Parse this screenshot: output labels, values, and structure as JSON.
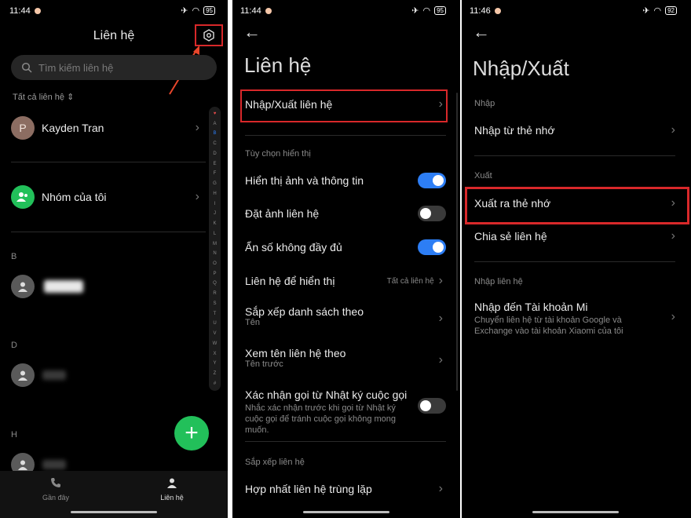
{
  "colors": {
    "accent": "#2d7ef5",
    "highlight": "#d8282a",
    "fab": "#22c05a",
    "background": "#000000"
  },
  "panel1": {
    "status": {
      "time": "11:44",
      "battery": "95"
    },
    "title": "Liên hệ",
    "search_placeholder": "Tìm kiếm liên hệ",
    "filter_label": "Tất cả liên hệ",
    "contacts": [
      {
        "initial": "P",
        "name": "Kayden Tran"
      },
      {
        "name": "Nhóm của tôi"
      }
    ],
    "section_b": "B",
    "section_d": "D",
    "section_h": "H",
    "alpha_index": [
      "♥",
      "A",
      "B",
      "C",
      "D",
      "E",
      "F",
      "G",
      "H",
      "I",
      "J",
      "K",
      "L",
      "M",
      "N",
      "O",
      "P",
      "Q",
      "R",
      "S",
      "T",
      "U",
      "V",
      "W",
      "X",
      "Y",
      "Z",
      "#"
    ],
    "tabs": [
      {
        "label": "Gần đây",
        "icon": "phone-icon"
      },
      {
        "label": "Liên hệ",
        "icon": "person-icon"
      }
    ]
  },
  "panel2": {
    "status": {
      "time": "11:44",
      "battery": "95"
    },
    "title": "Liên hệ",
    "import_export": "Nhập/Xuất liên hệ",
    "display_options_header": "Tùy chọn hiển thị",
    "rows": {
      "show_photo": "Hiển thị ảnh và thông tin",
      "set_photo": "Đặt ảnh liên hệ",
      "hide_incomplete": "Ẩn số không đầy đủ",
      "contacts_to_display": "Liên hệ để hiển thị",
      "contacts_to_display_value": "Tất cả liên hệ",
      "sort_by": "Sắp xếp danh sách theo",
      "sort_by_value": "Tên",
      "view_name_by": "Xem tên liên hệ theo",
      "view_name_by_value": "Tên trước",
      "confirm_call": "Xác nhận gọi từ Nhật ký cuộc gọi",
      "confirm_call_desc": "Nhắc xác nhận trước khi gọi từ Nhật ký cuộc gọi để tránh cuộc gọi không mong muốn.",
      "arrange_header": "Sắp xếp liên hệ",
      "merge": "Hợp nhất liên hệ trùng lặp"
    },
    "toggles": {
      "show_photo": true,
      "set_photo": false,
      "hide_incomplete": true,
      "confirm_call": false
    }
  },
  "panel3": {
    "status": {
      "time": "11:46",
      "battery": "92"
    },
    "title": "Nhập/Xuất",
    "import_header": "Nhập",
    "import_from_card": "Nhập từ thẻ nhớ",
    "export_header": "Xuất",
    "export_to_card": "Xuất ra thẻ nhớ",
    "share_contacts": "Chia sẻ liên hệ",
    "import_contacts_header": "Nhập liên hệ",
    "import_mi": "Nhập đến Tài khoản Mi",
    "import_mi_desc": "Chuyển liên hệ từ tài khoản Google và Exchange vào tài khoản Xiaomi của tôi"
  }
}
